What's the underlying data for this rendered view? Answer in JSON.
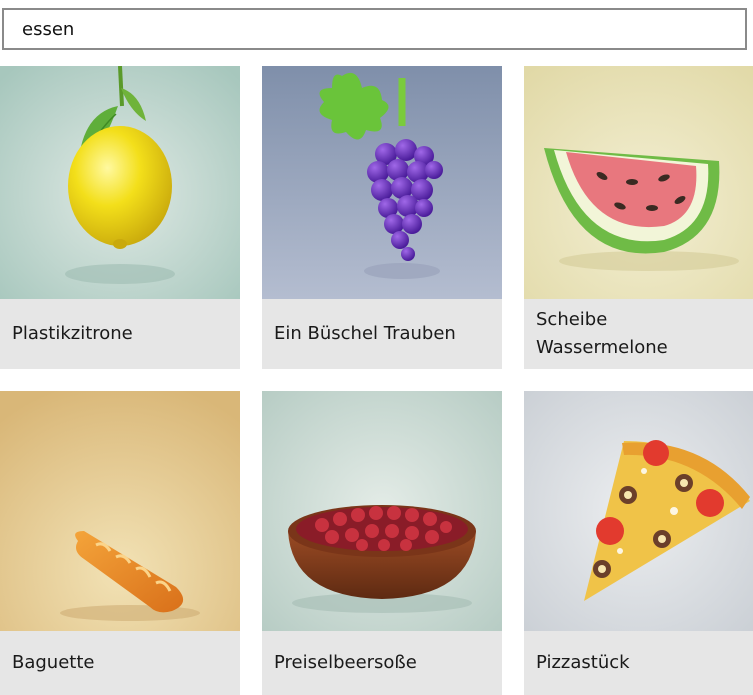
{
  "search": {
    "value": "essen"
  },
  "results": [
    {
      "label": "Plastikzitrone",
      "icon": "lemon-icon"
    },
    {
      "label": "Ein Büschel Trauben",
      "icon": "grapes-icon"
    },
    {
      "label": "Scheibe Wassermelone",
      "label_lines": [
        "Scheibe",
        "Wassermelone"
      ],
      "icon": "watermelon-slice-icon"
    },
    {
      "label": "Baguette",
      "icon": "baguette-icon"
    },
    {
      "label": "Preiselbeersoße",
      "icon": "cranberry-sauce-bowl-icon"
    },
    {
      "label": "Pizzastück",
      "icon": "pizza-slice-icon"
    }
  ],
  "colors": {
    "caption_bg": "#e6e6e6",
    "search_border": "#8a8a8a"
  }
}
